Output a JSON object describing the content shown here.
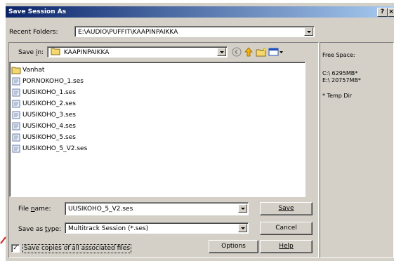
{
  "window": {
    "title": "Save Session As",
    "help_button": "?",
    "close_button": "×"
  },
  "recent_folders": {
    "label": "Recent Folders:",
    "value": "E:\\AUDIO\\PUFFIT\\KAAPINPAIKKA"
  },
  "save_in": {
    "label": "Save in:",
    "value": "KAAPINPAIKKA"
  },
  "files": [
    {
      "name": "Vanhat",
      "icon": "folder-icon"
    },
    {
      "name": "PORNOKOHO_1.ses",
      "icon": "session-file-icon"
    },
    {
      "name": "UUSIKOHO_1.ses",
      "icon": "session-file-icon"
    },
    {
      "name": "UUSIKOHO_2.ses",
      "icon": "session-file-icon"
    },
    {
      "name": "UUSIKOHO_3.ses",
      "icon": "session-file-icon"
    },
    {
      "name": "UUSIKOHO_4.ses",
      "icon": "session-file-icon"
    },
    {
      "name": "UUSIKOHO_5.ses",
      "icon": "session-file-icon"
    },
    {
      "name": "UUSIKOHO_5_V2.ses",
      "icon": "session-file-icon"
    }
  ],
  "file_name": {
    "label": "File name:",
    "value": "UUSIKOHO_5_V2.ses"
  },
  "save_as_type": {
    "label": "Save as type:",
    "value": "Multitrack Session (*.ses)"
  },
  "buttons": {
    "save": "Save",
    "cancel": "Cancel",
    "options": "Options",
    "help": "Help"
  },
  "save_copies": {
    "label": "Save copies of all associated files",
    "checked": true
  },
  "free_space": {
    "title": "Free Space:",
    "drives": [
      "C:\\  6295MB*",
      "E:\\  20757MB*"
    ],
    "note": "* Temp Dir"
  },
  "colors": {
    "title_gradient_start": "#0a246a",
    "title_gradient_end": "#a6caf0",
    "dialog_face": "#d4d0c8",
    "folder_yellow": "#f5d76e"
  }
}
